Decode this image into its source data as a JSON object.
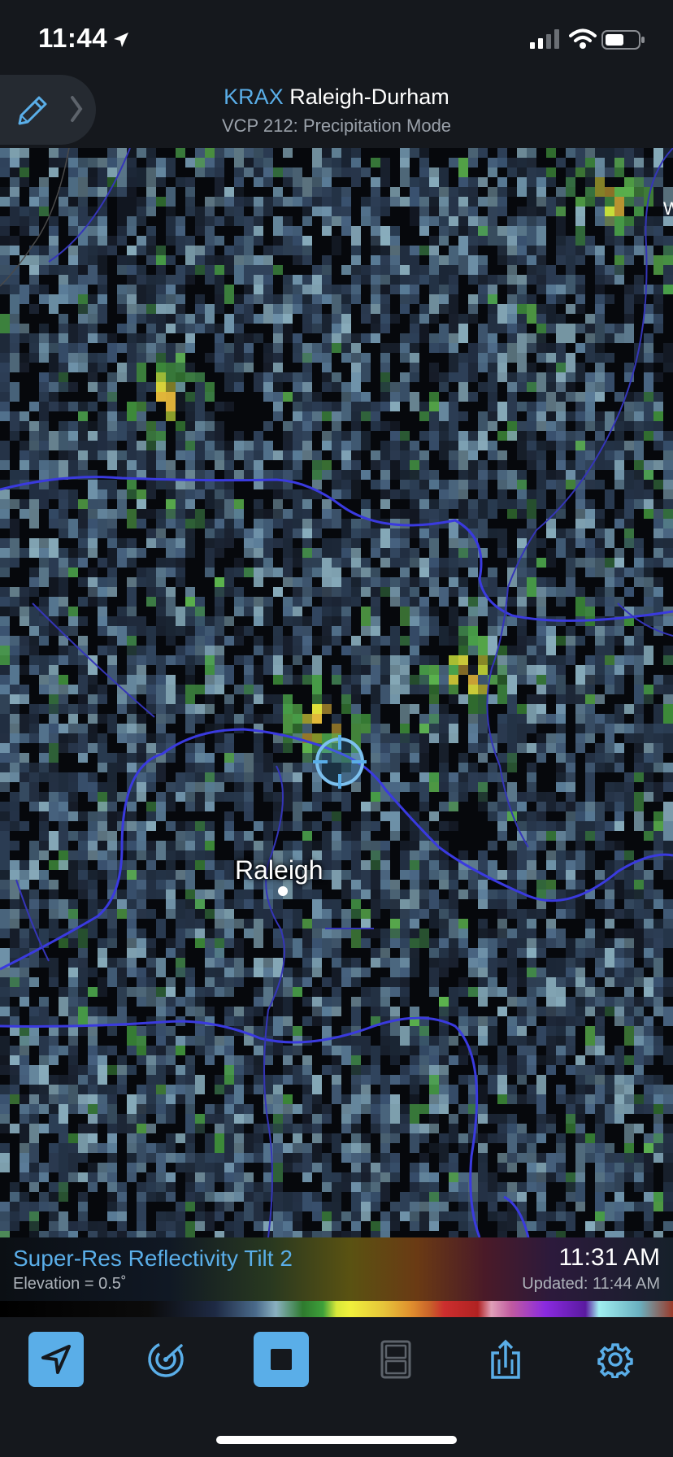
{
  "status_bar": {
    "time": "11:44",
    "location_icon": "location-arrow-icon",
    "signal_icon": "cellular-signal-icon",
    "wifi_icon": "wifi-icon",
    "battery_icon": "battery-icon"
  },
  "header": {
    "station_code": "KRAX",
    "station_name": "Raleigh-Durham",
    "vcp": "VCP 212: Precipitation Mode",
    "edit_icon": "pencil-icon",
    "expand_icon": "chevron-right-icon"
  },
  "map": {
    "city_label": "Raleigh",
    "edge_label": "W"
  },
  "info": {
    "product": "Super-Res Reflectivity Tilt 2",
    "elevation": "Elevation = 0.5˚",
    "time": "11:31 AM",
    "updated": "Updated: 11:44 AM"
  },
  "toolbar": {
    "items": [
      {
        "icon": "location-arrow-icon",
        "active": true
      },
      {
        "icon": "radar-icon",
        "active": false
      },
      {
        "icon": "stop-icon",
        "active": true
      },
      {
        "icon": "split-view-icon",
        "active": false
      },
      {
        "icon": "share-icon",
        "active": false
      },
      {
        "icon": "gear-icon",
        "active": false
      }
    ]
  },
  "colors": {
    "accent": "#5aaee8",
    "bar_background": "#15181d",
    "county_lines": "#3a3adf"
  }
}
